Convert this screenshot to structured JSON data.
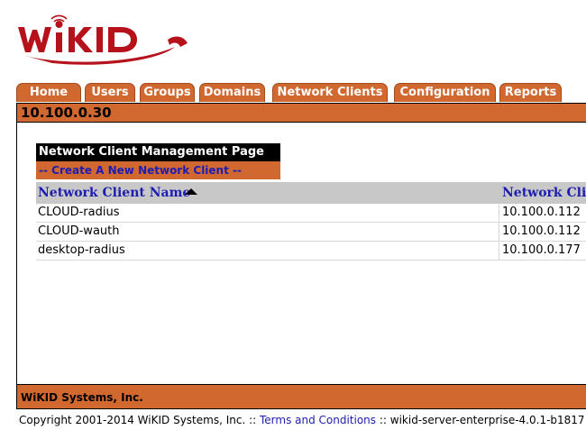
{
  "logo": {
    "text": "WiKID"
  },
  "tabs": [
    "Home",
    "Users",
    "Groups",
    "Domains",
    "Network Clients",
    "Configuration",
    "Reports"
  ],
  "titlebar": {
    "host": "10.100.0.30"
  },
  "page": {
    "heading": "Network Client Management Page",
    "create_link": "-- Create A New Network Client --"
  },
  "table": {
    "columns": [
      "Network Client Name",
      "Network Client"
    ],
    "sort": "ascending",
    "rows": [
      {
        "name": "CLOUD-radius",
        "ip": "10.100.0.112"
      },
      {
        "name": "CLOUD-wauth",
        "ip": "10.100.0.112"
      },
      {
        "name": "desktop-radius",
        "ip": "10.100.0.177"
      }
    ]
  },
  "company_bar": "WiKID Systems, Inc.",
  "footer": {
    "copyright": "Copyright 2001-2014 WiKID Systems, Inc. :: ",
    "terms_link": "Terms and Conditions",
    "version": " :: wikid-server-enterprise-4.0.1-b1817"
  },
  "colors": {
    "accent": "#d0682f",
    "link": "#1d1db0",
    "logo_red": "#b5121b"
  }
}
